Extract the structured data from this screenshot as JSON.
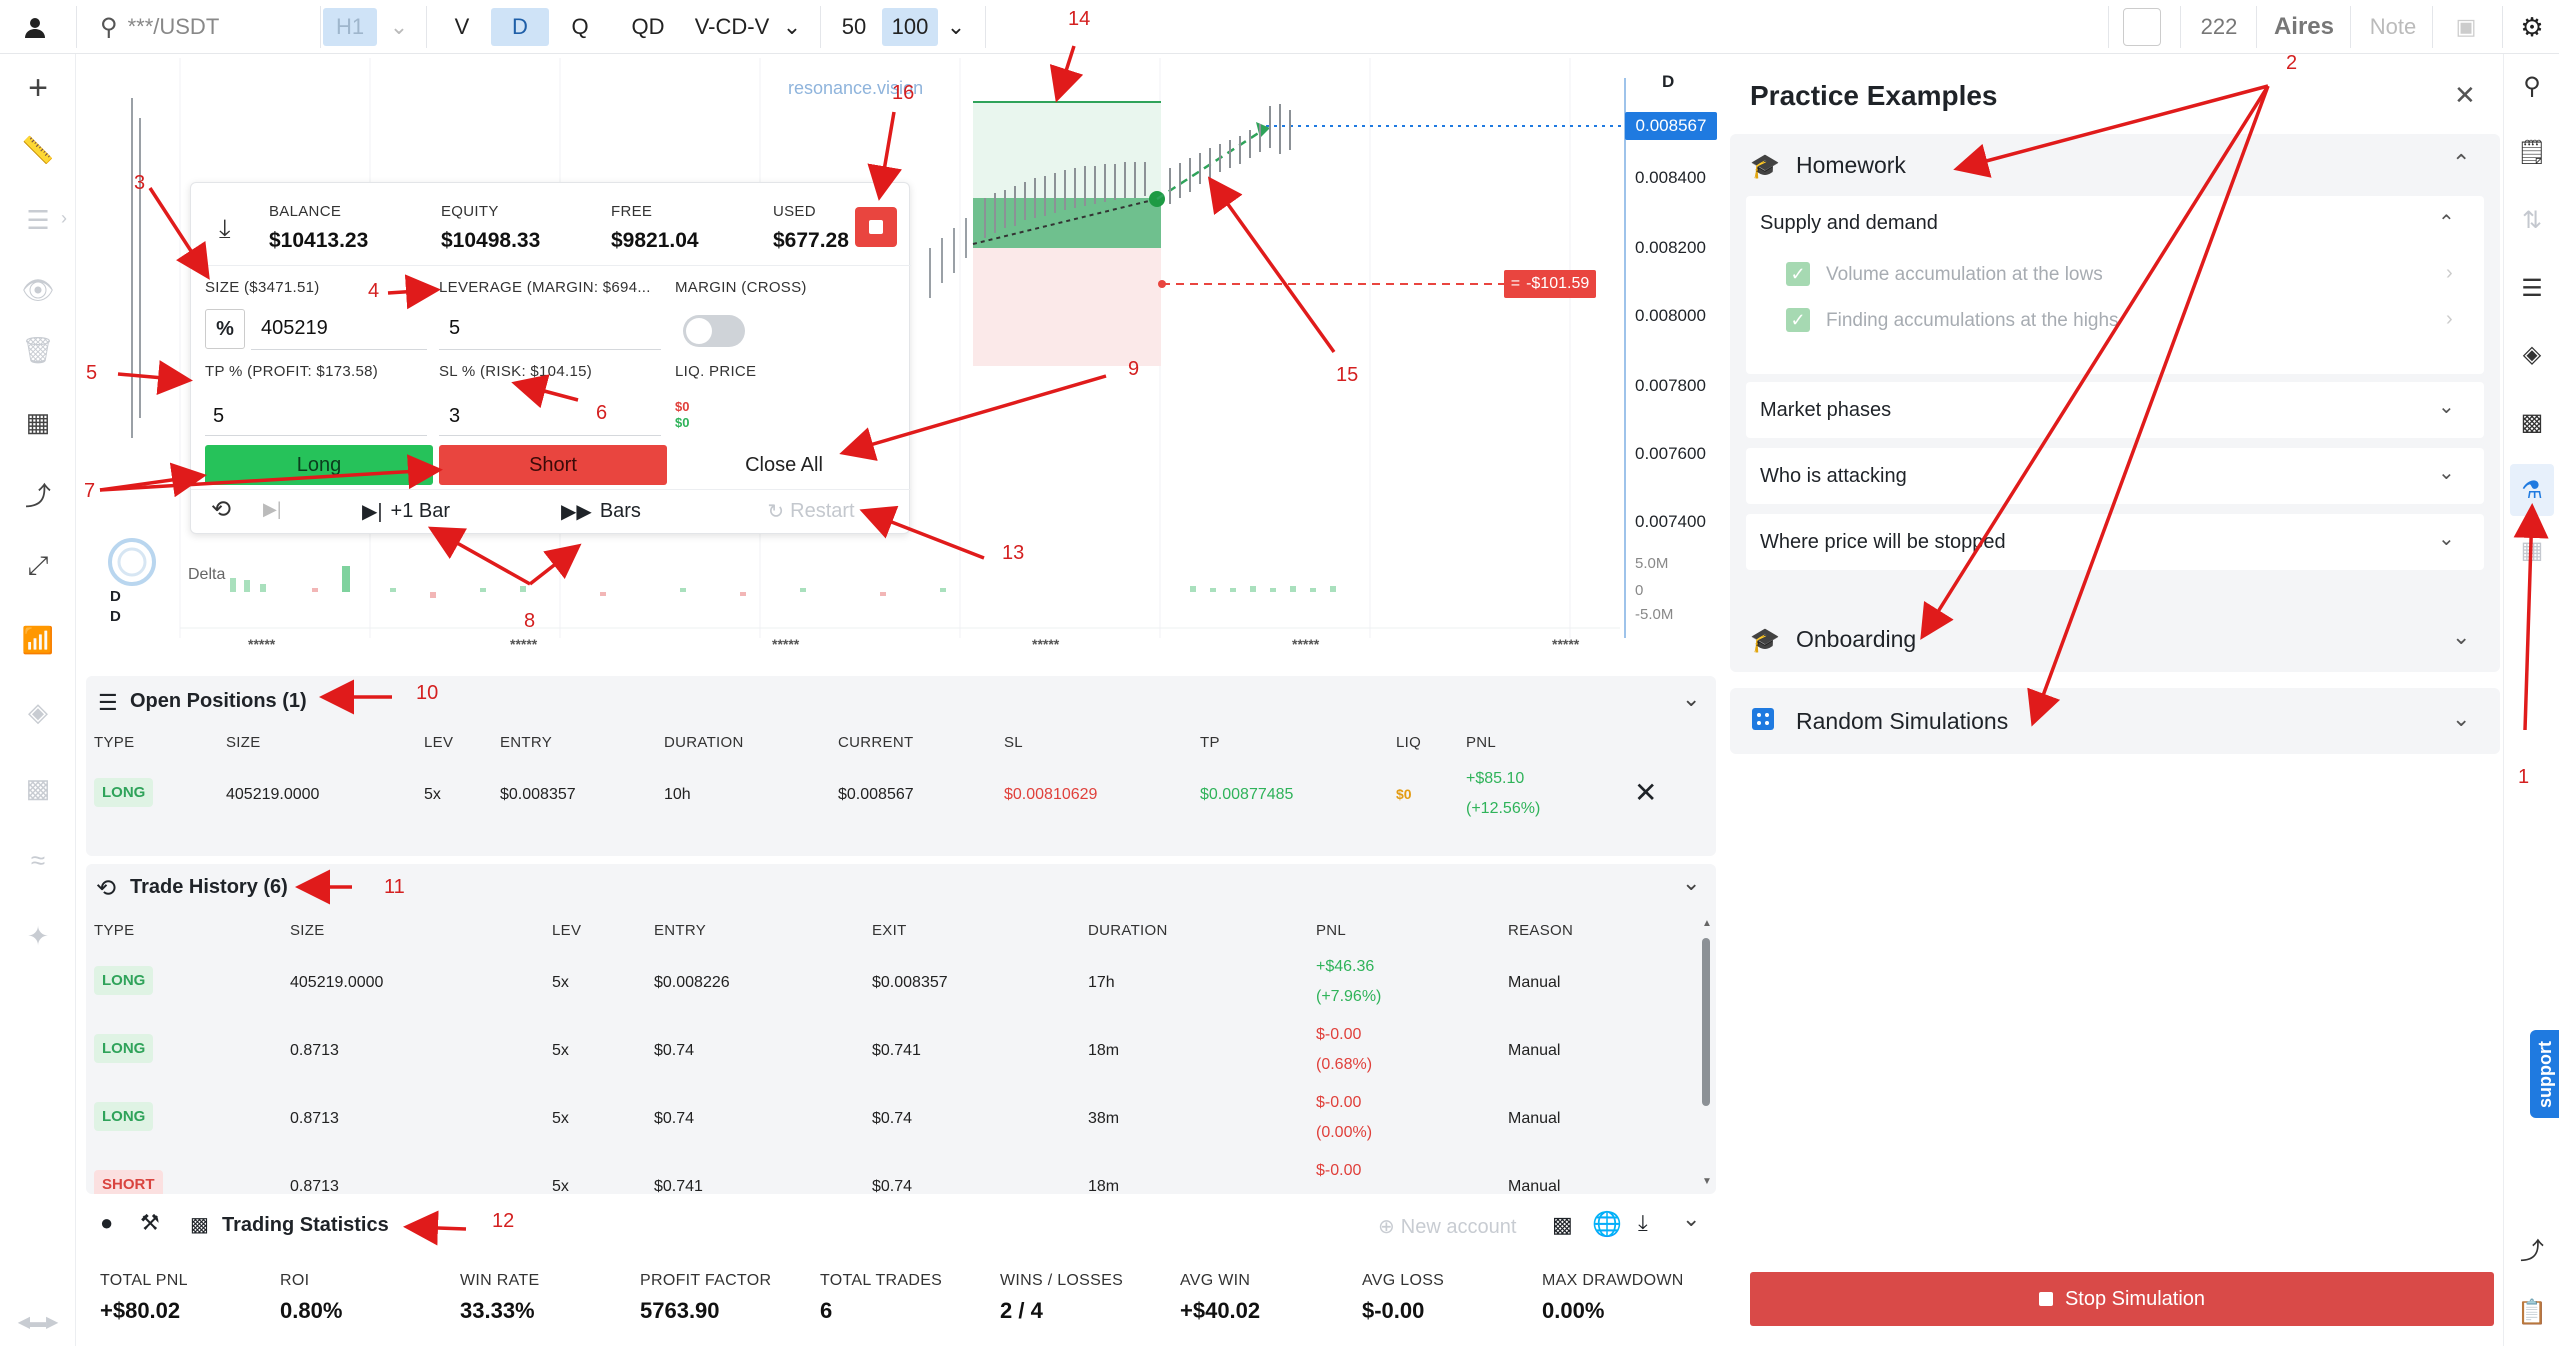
{
  "topbar": {
    "search_placeholder": "***/USDT",
    "timeframes": [
      "H1",
      "V",
      "D",
      "Q",
      "QD"
    ],
    "indicator": "V-CD-V",
    "counts": [
      "50",
      "100"
    ],
    "number": "222",
    "brand": "Aires",
    "note": "Note"
  },
  "chart": {
    "watermark": "resonance.vision",
    "symbol_label": "D",
    "current_price": "0.008567",
    "price_ticks": [
      "0.008400",
      "0.008200",
      "0.008000",
      "0.007800",
      "0.007600",
      "0.007400"
    ],
    "delta_label": "Delta",
    "delta_ticks": [
      "5.0M",
      "0",
      "-5.0M"
    ],
    "time_label": "*****",
    "sl_tag": "-$101.59",
    "side_label_d1": "D",
    "side_label_d2": "D"
  },
  "trade_panel": {
    "balance_label": "BALANCE",
    "balance": "$10413.23",
    "equity_label": "EQUITY",
    "equity": "$10498.33",
    "free_label": "FREE",
    "free": "$9821.04",
    "used_label": "USED",
    "used": "$677.28",
    "size_label": "SIZE ($3471.51)",
    "leverage_label": "LEVERAGE (MARGIN: $694...",
    "margin_label": "MARGIN (CROSS)",
    "size_unit": "%",
    "size_value": "405219",
    "leverage_value": "5",
    "tp_label": "TP % (PROFIT: $173.58)",
    "sl_label": "SL % (RISK: $104.15)",
    "liq_label": "LIQ. PRICE",
    "liq_red": "$0",
    "liq_green": "$0",
    "tp_value": "5",
    "sl_value": "3",
    "long_label": "Long",
    "short_label": "Short",
    "close_all_label": "Close All",
    "plus_bar_label": "+1 Bar",
    "bars_label": "Bars",
    "restart_label": "Restart"
  },
  "open_positions": {
    "title": "Open Positions (1)",
    "headers": [
      "TYPE",
      "SIZE",
      "LEV",
      "ENTRY",
      "DURATION",
      "CURRENT",
      "SL",
      "TP",
      "LIQ",
      "PNL"
    ],
    "rows": [
      {
        "type": "LONG",
        "size": "405219.0000",
        "lev": "5x",
        "entry": "$0.008357",
        "duration": "10h",
        "current": "$0.008567",
        "sl": "$0.00810629",
        "tp": "$0.00877485",
        "liq": "$0",
        "pnl": "+$85.10",
        "pnl_pct": "(+12.56%)"
      }
    ]
  },
  "trade_history": {
    "title": "Trade History (6)",
    "headers": [
      "TYPE",
      "SIZE",
      "LEV",
      "ENTRY",
      "EXIT",
      "DURATION",
      "PNL",
      "REASON"
    ],
    "rows": [
      {
        "type": "LONG",
        "size": "405219.0000",
        "lev": "5x",
        "entry": "$0.008226",
        "exit": "$0.008357",
        "duration": "17h",
        "pnl": "+$46.36",
        "pnl_pct": "(+7.96%)",
        "reason": "Manual"
      },
      {
        "type": "LONG",
        "size": "0.8713",
        "lev": "5x",
        "entry": "$0.74",
        "exit": "$0.741",
        "duration": "18m",
        "pnl": "$-0.00",
        "pnl_pct": "(0.68%)",
        "reason": "Manual"
      },
      {
        "type": "LONG",
        "size": "0.8713",
        "lev": "5x",
        "entry": "$0.74",
        "exit": "$0.74",
        "duration": "38m",
        "pnl": "$-0.00",
        "pnl_pct": "(0.00%)",
        "reason": "Manual"
      },
      {
        "type": "SHORT",
        "size": "0.8713",
        "lev": "5x",
        "entry": "$0.741",
        "exit": "$0.74",
        "duration": "18m",
        "pnl": "$-0.00",
        "pnl_pct": "",
        "reason": "Manual"
      }
    ]
  },
  "stats": {
    "title": "Trading Statistics",
    "new_account": "New account",
    "items": [
      {
        "label": "TOTAL PNL",
        "value": "+$80.02"
      },
      {
        "label": "ROI",
        "value": "0.80%"
      },
      {
        "label": "WIN RATE",
        "value": "33.33%"
      },
      {
        "label": "PROFIT FACTOR",
        "value": "5763.90"
      },
      {
        "label": "TOTAL TRADES",
        "value": "6"
      },
      {
        "label": "WINS / LOSSES",
        "value": "2 / 4"
      },
      {
        "label": "AVG WIN",
        "value": "+$40.02"
      },
      {
        "label": "AVG LOSS",
        "value": "$-0.00"
      },
      {
        "label": "MAX DRAWDOWN",
        "value": "0.00%"
      }
    ]
  },
  "practice": {
    "title": "Practice Examples",
    "homework": "Homework",
    "supply_demand": "Supply and demand",
    "lessons": [
      "Volume accumulation at the lows",
      "Finding accumulations at the highs"
    ],
    "market_phases": "Market phases",
    "who_attacking": "Who is attacking",
    "where_stopped": "Where price will be stopped",
    "onboarding": "Onboarding",
    "random": "Random Simulations",
    "stop": "Stop Simulation",
    "support": "support"
  },
  "annotations": [
    "1",
    "2",
    "3",
    "4",
    "5",
    "6",
    "7",
    "8",
    "9",
    "10",
    "11",
    "12",
    "13",
    "14",
    "15",
    "16"
  ],
  "colors": {
    "green": "#26c25a",
    "red": "#e9453f",
    "blue": "#1f7ae0",
    "anno": "#d42020"
  }
}
